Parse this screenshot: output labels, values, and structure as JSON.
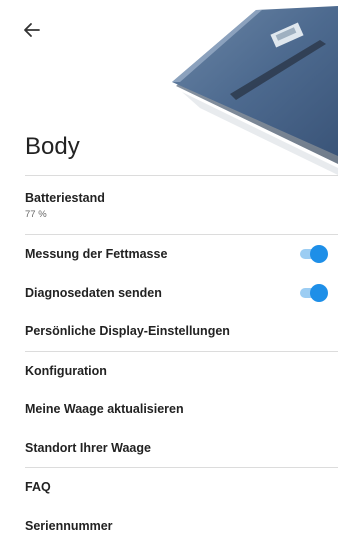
{
  "header": {
    "back_icon": "arrow-left-icon",
    "title": "Body"
  },
  "battery": {
    "label": "Batteriestand",
    "value": "77 %"
  },
  "settings": {
    "fat_mass": {
      "label": "Messung der Fettmasse",
      "enabled": true
    },
    "diagnostics": {
      "label": "Diagnosedaten senden",
      "enabled": true
    },
    "display": {
      "label": "Persönliche Display-Einstellungen"
    }
  },
  "menu": {
    "configuration": "Konfiguration",
    "update": "Meine Waage aktualisieren",
    "location": "Standort Ihrer Waage"
  },
  "info": {
    "faq": "FAQ",
    "serial": "Seriennummer"
  },
  "colors": {
    "toggle_on": "#1e8fe8",
    "toggle_track": "#9ccdf3",
    "divider": "#dcdcdc"
  }
}
